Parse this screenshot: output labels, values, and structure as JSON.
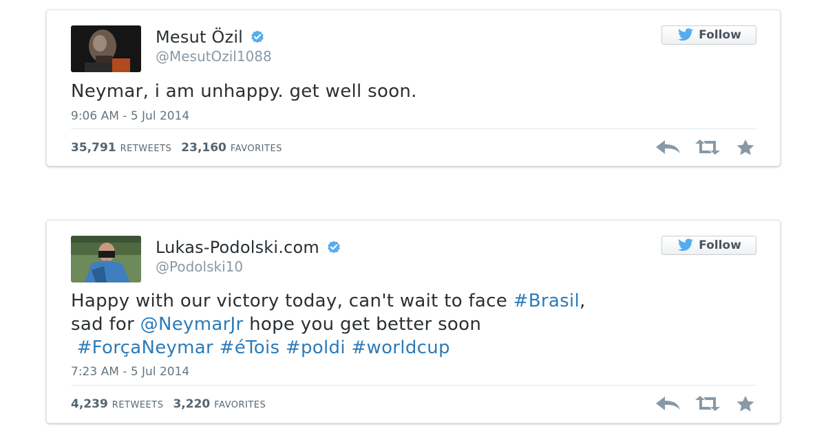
{
  "tweets": [
    {
      "display_name": "Mesut Özil",
      "handle": "@MesutOzil1088",
      "follow_label": "Follow",
      "text": "Neymar, i am unhappy. get well soon.",
      "timestamp": "9:06 AM - 5 Jul 2014",
      "retweets": "35,791",
      "retweets_label": "RETWEETS",
      "favorites": "23,160",
      "favorites_label": "FAVORITES"
    },
    {
      "display_name": "Lukas-Podolski.com",
      "handle": "@Podolski10",
      "follow_label": "Follow",
      "text_line1_a": "Happy with our victory today, can't wait to face ",
      "text_line1_link": "#Brasil",
      "text_line1_b": ",",
      "text_line2_a": "sad for ",
      "text_line2_link": "@NeymarJr",
      "text_line2_b": " hope you get better soon",
      "text_line3_links": [
        "#ForçaNeymar",
        "#éTois",
        "#poldi",
        "#worldcup"
      ],
      "timestamp": "7:23 AM - 5 Jul 2014",
      "retweets": "4,239",
      "retweets_label": "RETWEETS",
      "favorites": "3,220",
      "favorites_label": "FAVORITES"
    }
  ],
  "colors": {
    "link": "#2b7bb9",
    "verified": "#55acee",
    "action_icon": "#8899a6"
  }
}
